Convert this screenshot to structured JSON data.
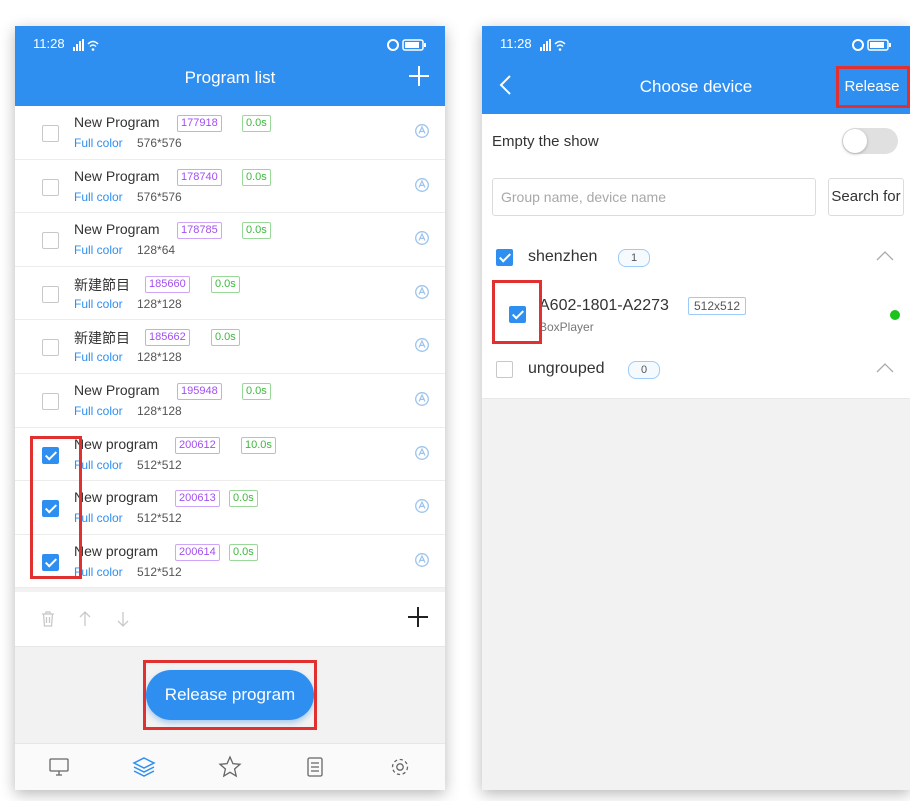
{
  "left": {
    "status": {
      "time": "11:28"
    },
    "title": "Program list",
    "programs": [
      {
        "name": "New Program",
        "id": "177918",
        "duration": "0.0s",
        "type": "Full color",
        "size": "576*576",
        "checked": false
      },
      {
        "name": "New Program",
        "id": "178740",
        "duration": "0.0s",
        "type": "Full color",
        "size": "576*576",
        "checked": false
      },
      {
        "name": "New Program",
        "id": "178785",
        "duration": "0.0s",
        "type": "Full color",
        "size": "128*64",
        "checked": false
      },
      {
        "name": "新建節目",
        "id": "185660",
        "duration": "0.0s",
        "type": "Full color",
        "size": "128*128",
        "checked": false
      },
      {
        "name": "新建節目",
        "id": "185662",
        "duration": "0.0s",
        "type": "Full color",
        "size": "128*128",
        "checked": false
      },
      {
        "name": "New Program",
        "id": "195948",
        "duration": "0.0s",
        "type": "Full color",
        "size": "128*128",
        "checked": false
      },
      {
        "name": "New program",
        "id": "200612",
        "duration": "10.0s",
        "type": "Full color",
        "size": "512*512",
        "checked": true
      },
      {
        "name": "New program",
        "id": "200613",
        "duration": "0.0s",
        "type": "Full color",
        "size": "512*512",
        "checked": true
      },
      {
        "name": "New program",
        "id": "200614",
        "duration": "0.0s",
        "type": "Full color",
        "size": "512*512",
        "checked": true
      }
    ],
    "release_label": "Release program",
    "nav": [
      "monitor-icon",
      "layers-icon",
      "star-icon",
      "list-icon",
      "gear-icon"
    ]
  },
  "right": {
    "status": {
      "time": "11:28"
    },
    "title": "Choose device",
    "release_label": "Release",
    "empty_show_label": "Empty the show",
    "search": {
      "placeholder": "Group name, device name",
      "button_label": "Search for"
    },
    "groups": [
      {
        "name": "shenzhen",
        "count": "1",
        "checked": true
      },
      {
        "name": "ungrouped",
        "count": "0",
        "checked": false
      }
    ],
    "device": {
      "name": "A602-1801-A2273",
      "resolution": "512x512",
      "player": "BoxPlayer",
      "checked": true
    }
  },
  "colors": {
    "primary": "#2f8ff0",
    "highlight": "#e03030",
    "online": "#1bc31b"
  }
}
